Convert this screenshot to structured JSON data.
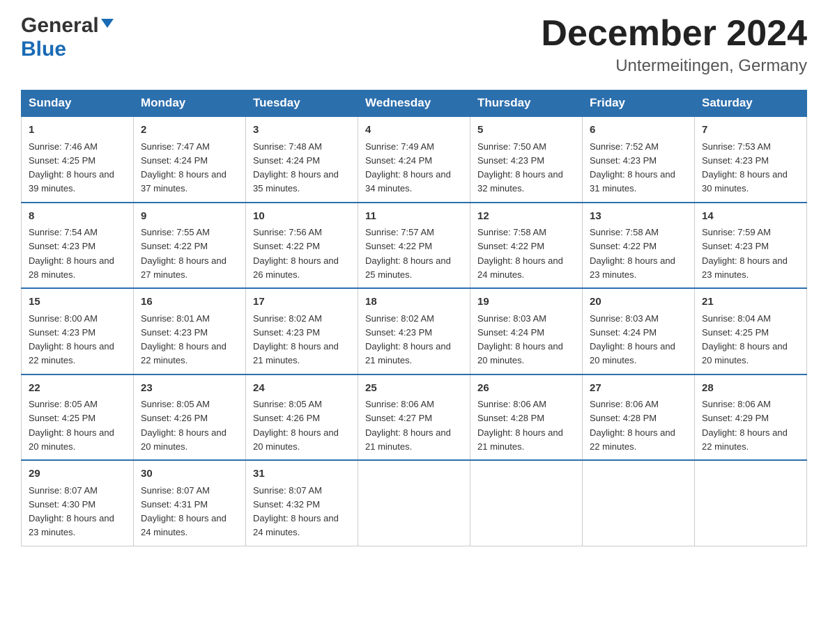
{
  "header": {
    "logo_general": "General",
    "logo_blue": "Blue",
    "month_title": "December 2024",
    "location": "Untermeitingen, Germany"
  },
  "weekdays": [
    "Sunday",
    "Monday",
    "Tuesday",
    "Wednesday",
    "Thursday",
    "Friday",
    "Saturday"
  ],
  "weeks": [
    [
      {
        "day": "1",
        "sunrise": "7:46 AM",
        "sunset": "4:25 PM",
        "daylight": "8 hours and 39 minutes."
      },
      {
        "day": "2",
        "sunrise": "7:47 AM",
        "sunset": "4:24 PM",
        "daylight": "8 hours and 37 minutes."
      },
      {
        "day": "3",
        "sunrise": "7:48 AM",
        "sunset": "4:24 PM",
        "daylight": "8 hours and 35 minutes."
      },
      {
        "day": "4",
        "sunrise": "7:49 AM",
        "sunset": "4:24 PM",
        "daylight": "8 hours and 34 minutes."
      },
      {
        "day": "5",
        "sunrise": "7:50 AM",
        "sunset": "4:23 PM",
        "daylight": "8 hours and 32 minutes."
      },
      {
        "day": "6",
        "sunrise": "7:52 AM",
        "sunset": "4:23 PM",
        "daylight": "8 hours and 31 minutes."
      },
      {
        "day": "7",
        "sunrise": "7:53 AM",
        "sunset": "4:23 PM",
        "daylight": "8 hours and 30 minutes."
      }
    ],
    [
      {
        "day": "8",
        "sunrise": "7:54 AM",
        "sunset": "4:23 PM",
        "daylight": "8 hours and 28 minutes."
      },
      {
        "day": "9",
        "sunrise": "7:55 AM",
        "sunset": "4:22 PM",
        "daylight": "8 hours and 27 minutes."
      },
      {
        "day": "10",
        "sunrise": "7:56 AM",
        "sunset": "4:22 PM",
        "daylight": "8 hours and 26 minutes."
      },
      {
        "day": "11",
        "sunrise": "7:57 AM",
        "sunset": "4:22 PM",
        "daylight": "8 hours and 25 minutes."
      },
      {
        "day": "12",
        "sunrise": "7:58 AM",
        "sunset": "4:22 PM",
        "daylight": "8 hours and 24 minutes."
      },
      {
        "day": "13",
        "sunrise": "7:58 AM",
        "sunset": "4:22 PM",
        "daylight": "8 hours and 23 minutes."
      },
      {
        "day": "14",
        "sunrise": "7:59 AM",
        "sunset": "4:23 PM",
        "daylight": "8 hours and 23 minutes."
      }
    ],
    [
      {
        "day": "15",
        "sunrise": "8:00 AM",
        "sunset": "4:23 PM",
        "daylight": "8 hours and 22 minutes."
      },
      {
        "day": "16",
        "sunrise": "8:01 AM",
        "sunset": "4:23 PM",
        "daylight": "8 hours and 22 minutes."
      },
      {
        "day": "17",
        "sunrise": "8:02 AM",
        "sunset": "4:23 PM",
        "daylight": "8 hours and 21 minutes."
      },
      {
        "day": "18",
        "sunrise": "8:02 AM",
        "sunset": "4:23 PM",
        "daylight": "8 hours and 21 minutes."
      },
      {
        "day": "19",
        "sunrise": "8:03 AM",
        "sunset": "4:24 PM",
        "daylight": "8 hours and 20 minutes."
      },
      {
        "day": "20",
        "sunrise": "8:03 AM",
        "sunset": "4:24 PM",
        "daylight": "8 hours and 20 minutes."
      },
      {
        "day": "21",
        "sunrise": "8:04 AM",
        "sunset": "4:25 PM",
        "daylight": "8 hours and 20 minutes."
      }
    ],
    [
      {
        "day": "22",
        "sunrise": "8:05 AM",
        "sunset": "4:25 PM",
        "daylight": "8 hours and 20 minutes."
      },
      {
        "day": "23",
        "sunrise": "8:05 AM",
        "sunset": "4:26 PM",
        "daylight": "8 hours and 20 minutes."
      },
      {
        "day": "24",
        "sunrise": "8:05 AM",
        "sunset": "4:26 PM",
        "daylight": "8 hours and 20 minutes."
      },
      {
        "day": "25",
        "sunrise": "8:06 AM",
        "sunset": "4:27 PM",
        "daylight": "8 hours and 21 minutes."
      },
      {
        "day": "26",
        "sunrise": "8:06 AM",
        "sunset": "4:28 PM",
        "daylight": "8 hours and 21 minutes."
      },
      {
        "day": "27",
        "sunrise": "8:06 AM",
        "sunset": "4:28 PM",
        "daylight": "8 hours and 22 minutes."
      },
      {
        "day": "28",
        "sunrise": "8:06 AM",
        "sunset": "4:29 PM",
        "daylight": "8 hours and 22 minutes."
      }
    ],
    [
      {
        "day": "29",
        "sunrise": "8:07 AM",
        "sunset": "4:30 PM",
        "daylight": "8 hours and 23 minutes."
      },
      {
        "day": "30",
        "sunrise": "8:07 AM",
        "sunset": "4:31 PM",
        "daylight": "8 hours and 24 minutes."
      },
      {
        "day": "31",
        "sunrise": "8:07 AM",
        "sunset": "4:32 PM",
        "daylight": "8 hours and 24 minutes."
      },
      null,
      null,
      null,
      null
    ]
  ],
  "labels": {
    "sunrise_prefix": "Sunrise: ",
    "sunset_prefix": "Sunset: ",
    "daylight_prefix": "Daylight: "
  }
}
